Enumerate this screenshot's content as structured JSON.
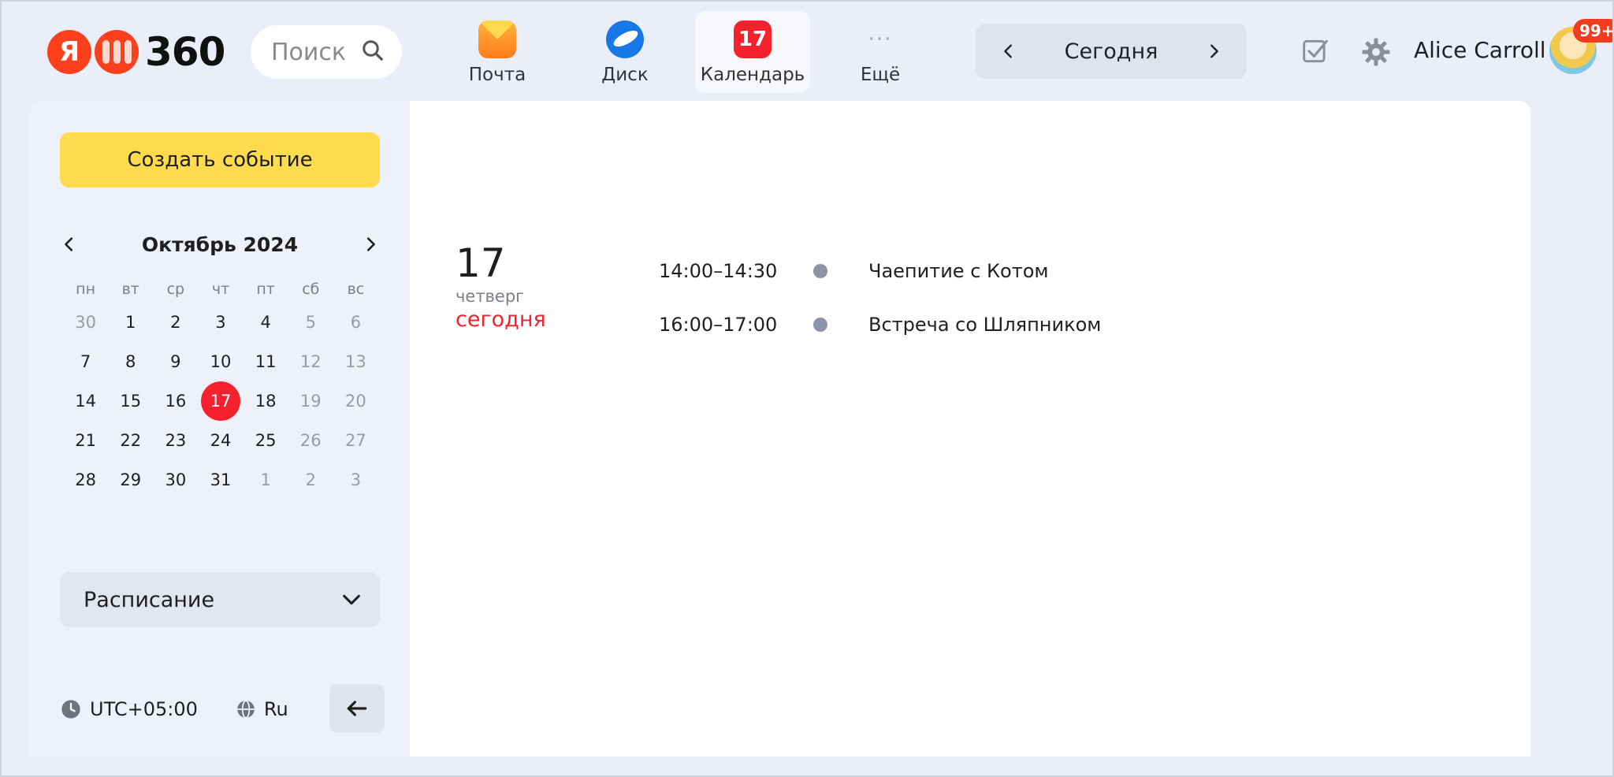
{
  "header": {
    "logo": {
      "letter": "Я",
      "suffix": "360"
    },
    "search": {
      "placeholder": "Поиск"
    },
    "apps": [
      {
        "label": "Почта",
        "icon": "mail-icon"
      },
      {
        "label": "Диск",
        "icon": "disk-icon"
      },
      {
        "label": "Календарь",
        "icon": "calendar-icon",
        "badge": "17",
        "active": true
      },
      {
        "label": "Ещё",
        "icon": "more-icon",
        "glyph": "···"
      }
    ],
    "today_nav": {
      "label": "Сегодня"
    },
    "user": {
      "name": "Alice Carroll",
      "badge": "99+"
    }
  },
  "sidebar": {
    "create_label": "Создать событие",
    "mini_calendar": {
      "month_label": "Октябрь 2024",
      "weekdays": [
        "пн",
        "вт",
        "ср",
        "чт",
        "пт",
        "сб",
        "вс"
      ],
      "weeks": [
        [
          "30",
          "1",
          "2",
          "3",
          "4",
          "5",
          "6"
        ],
        [
          "7",
          "8",
          "9",
          "10",
          "11",
          "12",
          "13"
        ],
        [
          "14",
          "15",
          "16",
          "17",
          "18",
          "19",
          "20"
        ],
        [
          "21",
          "22",
          "23",
          "24",
          "25",
          "26",
          "27"
        ],
        [
          "28",
          "29",
          "30",
          "31",
          "1",
          "2",
          "3"
        ]
      ],
      "today": "17"
    },
    "view_select": {
      "label": "Расписание"
    },
    "timezone": "UTC+05:00",
    "language": "Ru"
  },
  "schedule": {
    "day": {
      "number": "17",
      "weekday": "четверг",
      "today_label": "сегодня"
    },
    "events": [
      {
        "time": "14:00–14:30",
        "title": "Чаепитие с Котом"
      },
      {
        "time": "16:00–17:00",
        "title": "Встреча со Шляпником"
      }
    ]
  },
  "colors": {
    "accent_yellow": "#ffdb4d",
    "today_red": "#f5222d",
    "event_dot": "#8e93a8",
    "page_bg": "#eaeef9"
  }
}
